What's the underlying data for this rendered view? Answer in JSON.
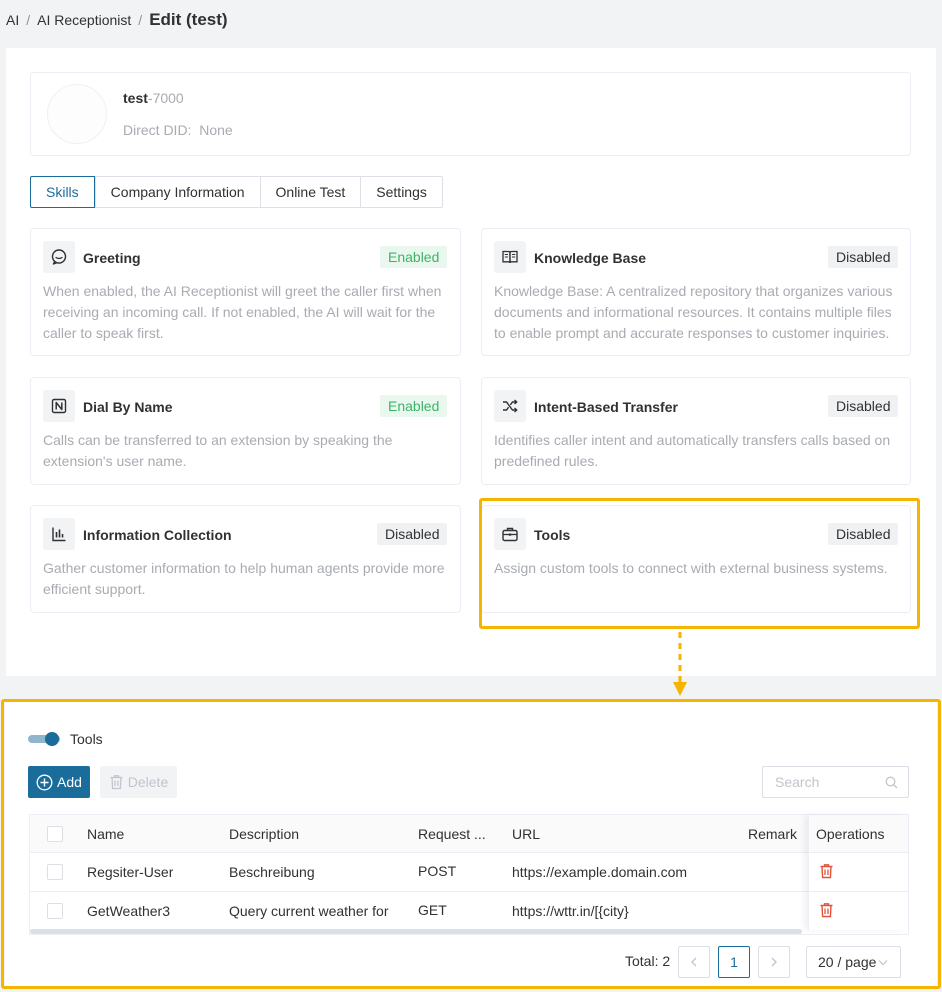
{
  "breadcrumb": {
    "items": [
      "AI",
      "AI Receptionist"
    ],
    "current": "Edit (test)"
  },
  "profile": {
    "name": "test",
    "ext": "-7000",
    "did_label": "Direct DID:",
    "did_value": "None"
  },
  "tabs": [
    "Skills",
    "Company Information",
    "Online Test",
    "Settings"
  ],
  "active_tab": "Skills",
  "skills": [
    {
      "title": "Greeting",
      "status": "Enabled",
      "icon": "chat-bubble-icon",
      "desc": [
        "When enabled, the AI Receptionist will greet the caller first when",
        "receiving an incoming call. If not enabled, the AI will wait for the",
        "caller to speak first."
      ]
    },
    {
      "title": "Knowledge Base",
      "status": "Disabled",
      "icon": "book-icon",
      "desc": [
        "Knowledge Base: A centralized repository that organizes various",
        "documents and informational resources. It contains multiple files",
        "to enable prompt and accurate responses to customer inquiries."
      ]
    },
    {
      "title": "Dial By Name",
      "status": "Enabled",
      "icon": "name-directory-icon",
      "desc": [
        "Calls can be transferred to an extension by speaking the",
        "extension's user name."
      ]
    },
    {
      "title": "Intent-Based Transfer",
      "status": "Disabled",
      "icon": "shuffle-icon",
      "desc": [
        "Identifies caller intent and automatically transfers calls based on",
        "predefined rules."
      ]
    },
    {
      "title": "Information Collection",
      "status": "Disabled",
      "icon": "bar-chart-icon",
      "desc": [
        "Gather customer information to help human agents provide more",
        "efficient support."
      ]
    },
    {
      "title": "Tools",
      "status": "Disabled",
      "icon": "toolbox-icon",
      "desc": [
        "Assign custom tools to connect with external business systems."
      ]
    }
  ],
  "tools_panel": {
    "toggle_label": "Tools",
    "toggle_on": true,
    "add_label": "Add",
    "delete_label": "Delete",
    "search_placeholder": "Search",
    "columns": [
      "Name",
      "Description",
      "Request ...",
      "URL",
      "Remark",
      "Operations"
    ],
    "rows": [
      {
        "name": "Regsiter-User",
        "description": "Beschreibung",
        "method": "POST",
        "url": "https://example.domain.com",
        "remark": ""
      },
      {
        "name": "GetWeather3",
        "description": "Query current weather for",
        "method": "GET",
        "url": "https://wttr.in/[{city}",
        "remark": ""
      }
    ],
    "total": "Total: 2",
    "page": "1",
    "page_size": "20 / page"
  },
  "colors": {
    "primary": "#1a6d9b",
    "enabled_text": "#3bb469",
    "enabled_bg": "#eaf7ee",
    "highlight": "#f5b400",
    "danger": "#e0533d"
  }
}
